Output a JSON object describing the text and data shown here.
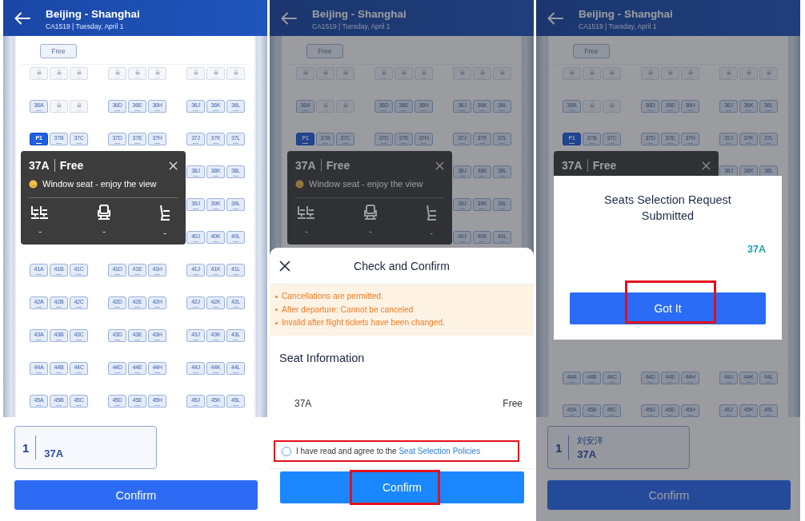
{
  "panels": [
    {
      "header": {
        "route": "Beijing - Shanghai",
        "flight": "CA1519 | Tuesday, April 1"
      },
      "legend": [
        "Free"
      ],
      "seat_rows": [
        {
          "seats": [
            {
              "locked": true
            },
            {
              "locked": true
            },
            {
              "locked": true
            },
            {
              "locked": true
            },
            {
              "locked": true
            },
            {
              "locked": true
            },
            {
              "locked": true
            },
            {
              "locked": true
            },
            {
              "locked": true
            }
          ]
        },
        {
          "seats": [
            {
              "label": "36A",
              "selected": false
            },
            {
              "locked": true
            },
            {
              "locked": true
            },
            {
              "label": "36D",
              "selected": false
            },
            {
              "label": "36E",
              "selected": false
            },
            {
              "label": "36H",
              "selected": false
            },
            {
              "label": "36J",
              "selected": false
            },
            {
              "label": "36K",
              "selected": false
            },
            {
              "label": "36L",
              "selected": false
            }
          ]
        },
        {
          "seats": [
            {
              "label": "P1",
              "selected": true
            },
            {
              "label": "37B",
              "selected": false
            },
            {
              "label": "37C",
              "selected": false
            },
            {
              "label": "37D",
              "selected": false
            },
            {
              "label": "37E",
              "selected": false
            },
            {
              "label": "37H",
              "selected": false
            },
            {
              "label": "37J",
              "selected": false
            },
            {
              "label": "37K",
              "selected": false
            },
            {
              "label": "37L",
              "selected": false
            }
          ]
        },
        {
          "seats": [
            {
              "label": "38J",
              "selected": false
            },
            {
              "label": "38K",
              "selected": false
            },
            {
              "label": "38L",
              "selected": false
            }
          ]
        },
        {
          "seats": [
            {
              "label": "39J",
              "selected": false
            },
            {
              "label": "39K",
              "selected": false
            },
            {
              "label": "39L",
              "selected": false
            }
          ]
        },
        {
          "seats": [
            {
              "label": "40J",
              "selected": false
            },
            {
              "label": "40K",
              "selected": false
            },
            {
              "label": "40L",
              "selected": false
            }
          ]
        },
        {
          "seats": [
            {
              "label": "41A",
              "selected": false
            },
            {
              "label": "41B",
              "selected": false
            },
            {
              "label": "41C",
              "selected": false
            },
            {
              "label": "41D",
              "selected": false
            },
            {
              "label": "41E",
              "selected": false
            },
            {
              "label": "41H",
              "selected": false
            },
            {
              "label": "41J",
              "selected": false
            },
            {
              "label": "41K",
              "selected": false
            },
            {
              "label": "41L",
              "selected": false
            }
          ]
        },
        {
          "seats": [
            {
              "label": "42A",
              "selected": false
            },
            {
              "label": "42B",
              "selected": false
            },
            {
              "label": "42C",
              "selected": false
            },
            {
              "label": "42D",
              "selected": false
            },
            {
              "label": "42E",
              "selected": false
            },
            {
              "label": "42H",
              "selected": false
            },
            {
              "label": "42J",
              "selected": false
            },
            {
              "label": "42K",
              "selected": false
            },
            {
              "label": "42L",
              "selected": false
            }
          ]
        },
        {
          "seats": [
            {
              "label": "43A",
              "selected": false
            },
            {
              "label": "43B",
              "selected": false
            },
            {
              "label": "43C",
              "selected": false
            },
            {
              "label": "43D",
              "selected": false
            },
            {
              "label": "43E",
              "selected": false
            },
            {
              "label": "43H",
              "selected": false
            },
            {
              "label": "43J",
              "selected": false
            },
            {
              "label": "43K",
              "selected": false
            },
            {
              "label": "43L",
              "selected": false
            }
          ]
        },
        {
          "seats": [
            {
              "label": "44A",
              "selected": false
            },
            {
              "label": "44B",
              "selected": false
            },
            {
              "label": "44C",
              "selected": false
            },
            {
              "label": "44D",
              "selected": false
            },
            {
              "label": "44E",
              "selected": false
            },
            {
              "label": "44H",
              "selected": false
            },
            {
              "label": "44J",
              "selected": false
            },
            {
              "label": "44K",
              "selected": false
            },
            {
              "label": "44L",
              "selected": false
            }
          ]
        },
        {
          "seats": [
            {
              "label": "45A",
              "selected": false
            },
            {
              "label": "45B",
              "selected": false
            },
            {
              "label": "45C",
              "selected": false
            },
            {
              "label": "45D",
              "selected": false
            },
            {
              "label": "45E",
              "selected": false
            },
            {
              "label": "45H",
              "selected": false
            },
            {
              "label": "45J",
              "selected": false
            },
            {
              "label": "45K",
              "selected": false
            },
            {
              "label": "45L",
              "selected": false
            }
          ]
        }
      ],
      "seat_popup": {
        "seat": "37A",
        "price": "Free",
        "note": "Window seat - enjoy the view",
        "features": [
          {
            "kind": "legroom",
            "value": "-"
          },
          {
            "kind": "seat",
            "value": "-"
          },
          {
            "kind": "recline",
            "value": "-"
          }
        ]
      },
      "passenger": {
        "index": "1",
        "seat": "37A"
      },
      "confirm_button": "Confirm"
    },
    {
      "header": {
        "route": "Beijing - Shanghai",
        "flight": "CA1519 | Tuesday, April 1"
      },
      "legend": [
        "Free"
      ],
      "seat_rows": [
        {
          "seats": [
            {
              "locked": true
            },
            {
              "locked": true
            },
            {
              "locked": true
            },
            {
              "locked": true
            },
            {
              "locked": true
            },
            {
              "locked": true
            },
            {
              "locked": true
            },
            {
              "locked": true
            },
            {
              "locked": true
            }
          ]
        },
        {
          "seats": [
            {
              "label": "36A",
              "selected": false
            },
            {
              "locked": true
            },
            {
              "locked": true
            },
            {
              "label": "36D",
              "selected": false
            },
            {
              "label": "36E",
              "selected": false
            },
            {
              "label": "36H",
              "selected": false
            },
            {
              "label": "36J",
              "selected": false
            },
            {
              "label": "36K",
              "selected": false
            },
            {
              "label": "36L",
              "selected": false
            }
          ]
        },
        {
          "seats": [
            {
              "label": "P1",
              "selected": true
            },
            {
              "label": "37B",
              "selected": false
            },
            {
              "label": "37C",
              "selected": false
            },
            {
              "label": "37D",
              "selected": false
            },
            {
              "label": "37E",
              "selected": false
            },
            {
              "label": "37H",
              "selected": false
            },
            {
              "label": "37J",
              "selected": false
            },
            {
              "label": "37K",
              "selected": false
            },
            {
              "label": "37L",
              "selected": false
            }
          ]
        },
        {
          "seats": [
            {
              "label": "38J",
              "selected": false
            },
            {
              "label": "38K",
              "selected": false
            },
            {
              "label": "38L",
              "selected": false
            }
          ]
        },
        {
          "seats": [
            {
              "label": "39J",
              "selected": false
            },
            {
              "label": "39K",
              "selected": false
            },
            {
              "label": "39L",
              "selected": false
            }
          ]
        },
        {
          "seats": [
            {
              "label": "40J",
              "selected": false
            },
            {
              "label": "40K",
              "selected": false
            },
            {
              "label": "40L",
              "selected": false
            }
          ]
        }
      ],
      "seat_popup": {
        "seat": "37A",
        "price": "Free",
        "note": "Window seat - enjoy the view",
        "features": [
          {
            "kind": "legroom",
            "value": "-"
          },
          {
            "kind": "seat",
            "value": "-"
          },
          {
            "kind": "recline",
            "value": "-"
          }
        ]
      },
      "sheet": {
        "title": "Check and Confirm",
        "notices": [
          "Cancellations are permitted.",
          "After departure: Cannot be canceled",
          "Invalid after flight tickets have been changed."
        ],
        "section_title": "Seat Information",
        "seat": "37A",
        "price": "Free",
        "agreement": {
          "text": "I have read and agree to the ",
          "link": "Seat Selection Policies",
          "checked": false,
          "highlighted": true
        },
        "confirm_button": {
          "label": "Confirm",
          "highlighted": true
        }
      }
    },
    {
      "header": {
        "route": "Beijing - Shanghai",
        "flight": "CA1519 | Tuesday, April 1"
      },
      "legend": [
        "Free"
      ],
      "seat_rows": [
        {
          "seats": [
            {
              "locked": true
            },
            {
              "locked": true
            },
            {
              "locked": true
            },
            {
              "locked": true
            },
            {
              "locked": true
            },
            {
              "locked": true
            },
            {
              "locked": true
            },
            {
              "locked": true
            },
            {
              "locked": true
            }
          ]
        },
        {
          "seats": [
            {
              "label": "36A",
              "selected": false
            },
            {
              "locked": true
            },
            {
              "locked": true
            },
            {
              "label": "36D",
              "selected": false
            },
            {
              "label": "36E",
              "selected": false
            },
            {
              "label": "36H",
              "selected": false
            },
            {
              "label": "36J",
              "selected": false
            },
            {
              "label": "36K",
              "selected": false
            },
            {
              "label": "36L",
              "selected": false
            }
          ]
        },
        {
          "seats": [
            {
              "label": "P1",
              "selected": true
            },
            {
              "label": "37B",
              "selected": false
            },
            {
              "label": "37C",
              "selected": false
            },
            {
              "label": "37D",
              "selected": false
            },
            {
              "label": "37E",
              "selected": false
            },
            {
              "label": "37H",
              "selected": false
            },
            {
              "label": "37J",
              "selected": false
            },
            {
              "label": "37K",
              "selected": false
            },
            {
              "label": "37L",
              "selected": false
            }
          ]
        },
        {
          "seats": [
            {
              "label": "38J",
              "selected": false
            },
            {
              "label": "38K",
              "selected": false
            },
            {
              "label": "38L",
              "selected": false
            }
          ]
        }
      ],
      "seat_rows_below": [
        {
          "seats": [
            {
              "label": "44A",
              "selected": false
            },
            {
              "label": "44B",
              "selected": false
            },
            {
              "label": "44C",
              "selected": false
            },
            {
              "label": "44D",
              "selected": false
            },
            {
              "label": "44E",
              "selected": false
            },
            {
              "label": "44H",
              "selected": false
            },
            {
              "label": "44J",
              "selected": false
            },
            {
              "label": "44K",
              "selected": false
            },
            {
              "label": "44L",
              "selected": false
            }
          ]
        },
        {
          "seats": [
            {
              "label": "45A",
              "selected": false
            },
            {
              "label": "45B",
              "selected": false
            },
            {
              "label": "45C",
              "selected": false
            },
            {
              "label": "45D",
              "selected": false
            },
            {
              "label": "45E",
              "selected": false
            },
            {
              "label": "45H",
              "selected": false
            },
            {
              "label": "45J",
              "selected": false
            },
            {
              "label": "45K",
              "selected": false
            },
            {
              "label": "45L",
              "selected": false
            }
          ]
        }
      ],
      "seat_popup": {
        "seat": "37A",
        "price": "Free"
      },
      "passenger": {
        "index": "1",
        "name": "刘安洋",
        "seat": "37A"
      },
      "confirm_button": "Confirm",
      "dialog": {
        "title": "Seats Selection Request Submitted",
        "seat": "37A",
        "button": {
          "label": "Got It",
          "highlighted": true
        }
      }
    }
  ]
}
